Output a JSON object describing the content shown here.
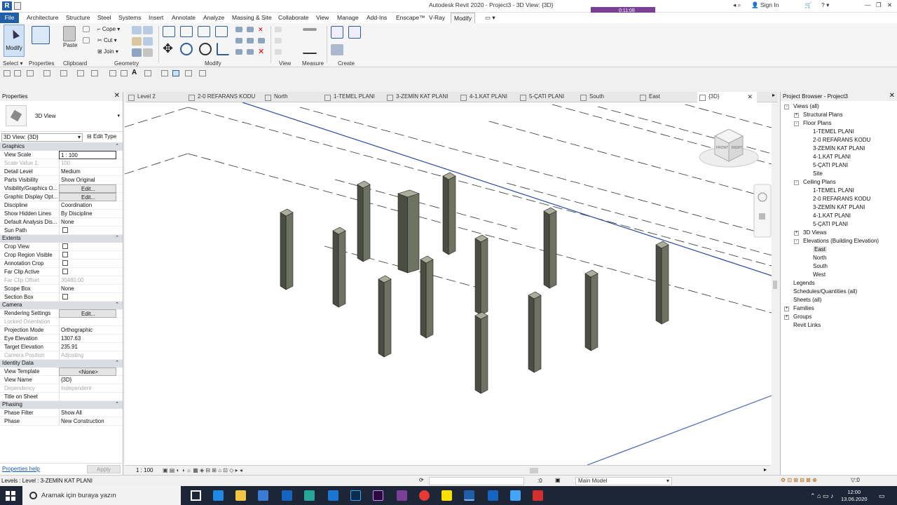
{
  "window": {
    "title": "Autodesk Revit 2020 - Project3 - 3D View: {3D}",
    "sign_in": "Sign In",
    "recording": "0:11:08"
  },
  "menu": [
    "File",
    "Architecture",
    "Structure",
    "Steel",
    "Systems",
    "Insert",
    "Annotate",
    "Analyze",
    "Massing & Site",
    "Collaborate",
    "View",
    "Manage",
    "Add-Ins",
    "Enscape™",
    "V-Ray",
    "Modify"
  ],
  "ribbon": {
    "modify": "Modify",
    "properties": "Properties",
    "paste": "Paste",
    "cope": "Cope",
    "cut": "Cut",
    "join": "Join",
    "panels": [
      "Select",
      "Properties",
      "Clipboard",
      "Geometry",
      "Modify",
      "View",
      "Measure",
      "Create"
    ]
  },
  "tabs": [
    "Level 2",
    "2-0 REFARANS KODU",
    "North",
    "1-TEMEL PLANI",
    "3-ZEMİN KAT PLANI",
    "4-1.KAT PLANI",
    "5-ÇATI PLANI",
    "South",
    "East",
    "{3D}"
  ],
  "properties": {
    "title": "Properties",
    "type_name": "3D View",
    "view_selector": "3D View: {3D}",
    "edit_type": "Edit Type",
    "sections": [
      {
        "name": "Graphics",
        "rows": [
          [
            "View Scale",
            "1 : 100",
            "inp"
          ],
          [
            "Scale Value    1:",
            "100",
            "dis"
          ],
          [
            "Detail Level",
            "Medium",
            ""
          ],
          [
            "Parts Visibility",
            "Show Original",
            ""
          ],
          [
            "Visibility/Graphics O...",
            "Edit...",
            "btn"
          ],
          [
            "Graphic Display Opt...",
            "Edit...",
            "btn"
          ],
          [
            "Discipline",
            "Coordination",
            ""
          ],
          [
            "Show Hidden Lines",
            "By Discipline",
            ""
          ],
          [
            "Default Analysis Dis...",
            "None",
            ""
          ],
          [
            "Sun Path",
            "",
            "cb"
          ]
        ]
      },
      {
        "name": "Extents",
        "rows": [
          [
            "Crop View",
            "",
            "cb"
          ],
          [
            "Crop Region Visible",
            "",
            "cb"
          ],
          [
            "Annotation Crop",
            "",
            "cb"
          ],
          [
            "Far Clip Active",
            "",
            "cb"
          ],
          [
            "Far Clip Offset",
            "30480.00",
            "dis"
          ],
          [
            "Scope Box",
            "None",
            ""
          ],
          [
            "Section Box",
            "",
            "cb"
          ]
        ]
      },
      {
        "name": "Camera",
        "rows": [
          [
            "Rendering Settings",
            "Edit...",
            "btn"
          ],
          [
            "Locked Orientation",
            "",
            "dis"
          ],
          [
            "Projection Mode",
            "Orthographic",
            ""
          ],
          [
            "Eye Elevation",
            "1307.63",
            ""
          ],
          [
            "Target Elevation",
            "235.91",
            ""
          ],
          [
            "Camera Position",
            "Adjusting",
            "dis"
          ]
        ]
      },
      {
        "name": "Identity Data",
        "rows": [
          [
            "View Template",
            "<None>",
            "btn"
          ],
          [
            "View Name",
            "{3D}",
            ""
          ],
          [
            "Dependency",
            "Independent",
            "dis"
          ],
          [
            "Title on Sheet",
            "",
            ""
          ]
        ]
      },
      {
        "name": "Phasing",
        "rows": [
          [
            "Phase Filter",
            "Show All",
            ""
          ],
          [
            "Phase",
            "New Construction",
            ""
          ]
        ]
      }
    ],
    "help": "Properties help",
    "apply": "Apply"
  },
  "view": {
    "scale": "1 : 100",
    "viewcube_front": "FRONT",
    "viewcube_right": "RIGHT"
  },
  "browser": {
    "title": "Project Browser - Project3",
    "tree": [
      {
        "t": "Views (all)",
        "d": 0,
        "g": "-"
      },
      {
        "t": "Structural Plans",
        "d": 1,
        "g": "+"
      },
      {
        "t": "Floor Plans",
        "d": 1,
        "g": "-"
      },
      {
        "t": "1-TEMEL PLANI",
        "d": 2
      },
      {
        "t": "2-0 REFARANS KODU",
        "d": 2
      },
      {
        "t": "3-ZEMİN KAT PLANI",
        "d": 2
      },
      {
        "t": "4-1.KAT PLANI",
        "d": 2
      },
      {
        "t": "5-ÇATI PLANI",
        "d": 2
      },
      {
        "t": "Site",
        "d": 2
      },
      {
        "t": "Ceiling Plans",
        "d": 1,
        "g": "-"
      },
      {
        "t": "1-TEMEL PLANI",
        "d": 2
      },
      {
        "t": "2-0 REFARANS KODU",
        "d": 2
      },
      {
        "t": "3-ZEMİN KAT PLANI",
        "d": 2
      },
      {
        "t": "4-1.KAT PLANI",
        "d": 2
      },
      {
        "t": "5-ÇATI PLANI",
        "d": 2
      },
      {
        "t": "3D Views",
        "d": 1,
        "g": "+"
      },
      {
        "t": "Elevations (Building Elevation)",
        "d": 1,
        "g": "-"
      },
      {
        "t": "East",
        "d": 2,
        "s": true
      },
      {
        "t": "North",
        "d": 2
      },
      {
        "t": "South",
        "d": 2
      },
      {
        "t": "West",
        "d": 2
      },
      {
        "t": "Legends",
        "d": 0
      },
      {
        "t": "Schedules/Quantities (all)",
        "d": 0
      },
      {
        "t": "Sheets (all)",
        "d": 0
      },
      {
        "t": "Families",
        "d": 0,
        "g": "+"
      },
      {
        "t": "Groups",
        "d": 0,
        "g": "+"
      },
      {
        "t": "Revit Links",
        "d": 0
      }
    ]
  },
  "status": {
    "text": "Levels : Level : 3-ZEMİN KAT PLANI",
    "model": "Main Model",
    "zero": ":0"
  },
  "taskbar": {
    "search": "Aramak için buraya yazın",
    "time": "12:00",
    "date": "13.06.2020"
  }
}
